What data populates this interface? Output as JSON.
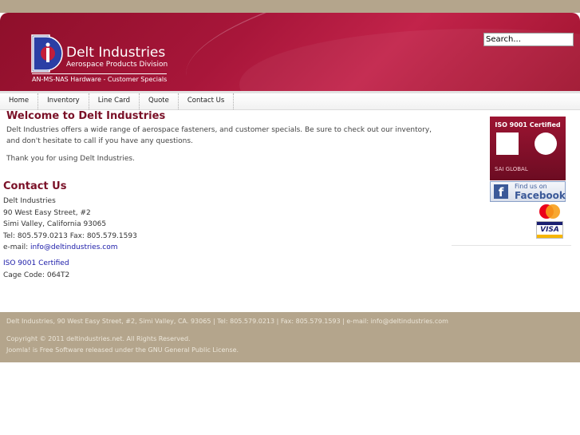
{
  "site": {
    "name": "Delt Industries",
    "division": "Aerospace Products Division",
    "tagline": "AN-MS-NAS Hardware - Customer Specials",
    "logo_letter": "D"
  },
  "search": {
    "value": "Search..."
  },
  "nav": [
    "Home",
    "Inventory",
    "Line Card",
    "Quote",
    "Contact Us"
  ],
  "welcome": {
    "title": "Welcome to Delt Industries",
    "paragraph1": "Delt Industries offers a wide range of aerospace fasteners, and customer specials. Be sure to check out our inventory, and don't hesitate to call if you have any questions.",
    "paragraph2": "Thank you for using Delt Industries."
  },
  "contact": {
    "title": "Contact Us",
    "company": "Delt Industries",
    "street": "90 West Easy Street, #2",
    "city": "Simi Valley, California 93065",
    "phone_fax": "Tel: 805.579.0213 Fax: 805.579.1593",
    "email_label": "e-mail:",
    "email": "info@deltindustries.com",
    "iso_link": "ISO 9001 Certified",
    "cage_code": "Cage Code: 064T2"
  },
  "sidebar": {
    "iso_badge": "ISO 9001 Certified",
    "iso_sub": "SAI GLOBAL",
    "facebook_top": "Find us on",
    "facebook_bottom": "Facebook",
    "visa": "VISA",
    "mastercard": "MasterCard"
  },
  "footer": {
    "line1": "Delt Industries, 90 West Easy Street, #2, Simi Valley, CA. 93065 | Tel: 805.579.0213 | Fax: 805.579.1593 | e-mail: info@deltindustries.com",
    "line2": "Copyright © 2011 deltindustries.net. All Rights Reserved.",
    "line3": "Joomla! is Free Software released under the GNU General Public License."
  },
  "colors": {
    "header_red": "#a8163a",
    "heading_maroon": "#7a1027",
    "footer_tan": "#b4a58c",
    "link_blue": "#1a1aa8"
  }
}
